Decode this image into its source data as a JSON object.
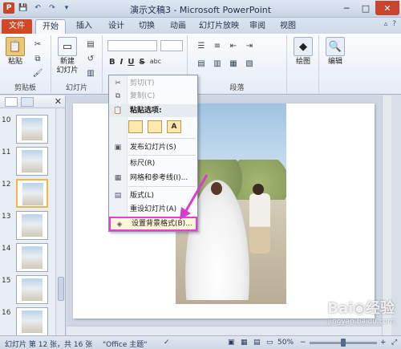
{
  "window": {
    "title": "演示文稿3 - Microsoft PowerPoint",
    "qat_icons": [
      "powerpoint-logo",
      "save-icon",
      "undo-icon",
      "redo-icon",
      "customize-icon"
    ],
    "controls": [
      "minimize",
      "maximize",
      "close"
    ]
  },
  "tabs": [
    "文件",
    "开始",
    "插入",
    "设计",
    "切换",
    "动画",
    "幻灯片放映",
    "审阅",
    "视图"
  ],
  "ribbon": {
    "groups": {
      "clipboard": {
        "label": "剪贴板",
        "paste": "粘贴"
      },
      "slides": {
        "label": "幻灯片",
        "new_slide_line1": "新建",
        "new_slide_line2": "幻灯片"
      },
      "font_format": [
        "B",
        "I",
        "U",
        "S",
        "abc"
      ],
      "paragraph": {
        "label": "段落"
      },
      "drawing": {
        "label": "绘图"
      },
      "editing": {
        "label": "编辑"
      }
    }
  },
  "slide_pane": {
    "items": [
      {
        "number": "10",
        "selected": false
      },
      {
        "number": "11",
        "selected": false
      },
      {
        "number": "12",
        "selected": true
      },
      {
        "number": "13",
        "selected": false
      },
      {
        "number": "14",
        "selected": false
      },
      {
        "number": "15",
        "selected": false
      },
      {
        "number": "16",
        "selected": false
      }
    ]
  },
  "context_menu": {
    "cut": "剪切(T)",
    "copy": "复制(C)",
    "paste_options": "粘贴选项:",
    "paste_buttons": [
      "",
      "",
      "A"
    ],
    "publish": "发布幻灯片(S)",
    "ruler": "标尺(R)",
    "grid": "网格和参考线(I)...",
    "layout": "版式(L)",
    "reset": "重设幻灯片(A)",
    "format_background": "设置背景格式(B)..."
  },
  "status": {
    "slide_info": "幻灯片 第 12 张，共 16 张",
    "theme": "\"Office 主题\"",
    "zoom": "50%",
    "zoom_level": 0.5
  },
  "watermark": {
    "line2": "jingyan.baidu.com"
  },
  "colors": {
    "file_tab": "#d24726",
    "highlight_border": "#e83fd2",
    "arrow": "#d63cd0"
  }
}
